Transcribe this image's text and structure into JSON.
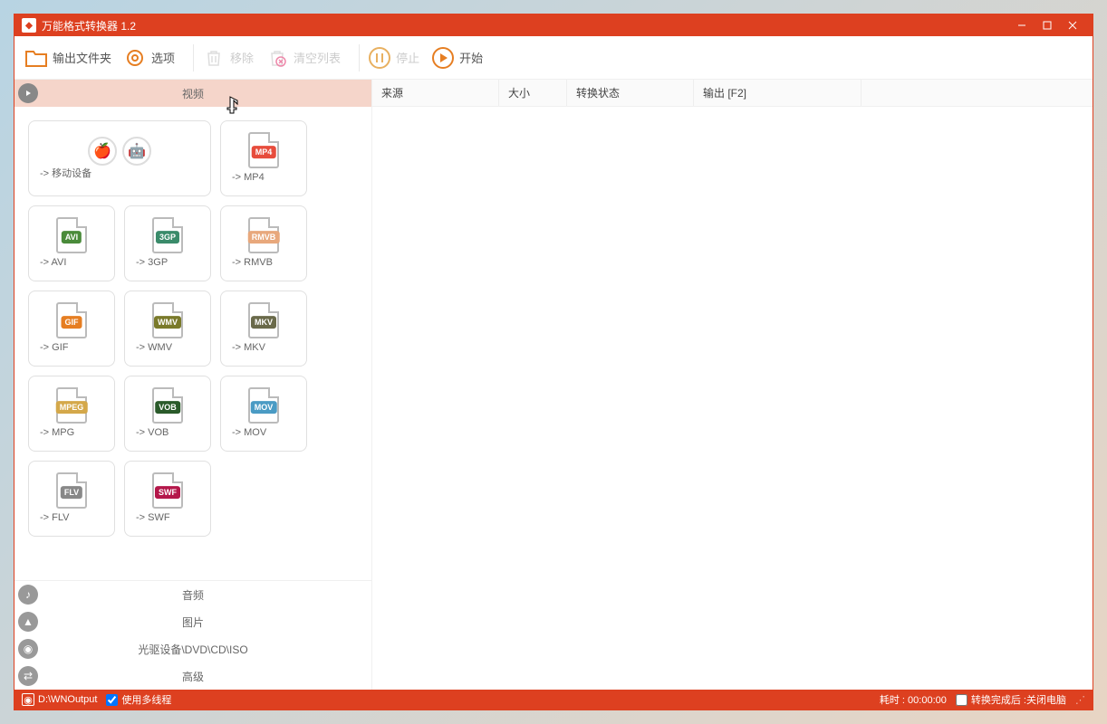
{
  "window": {
    "title": "万能格式转换器 1.2"
  },
  "toolbar": {
    "output_folder": "输出文件夹",
    "options": "选项",
    "remove": "移除",
    "clear_list": "清空列表",
    "stop": "停止",
    "start": "开始"
  },
  "categories": {
    "video": "视频",
    "audio": "音频",
    "image": "图片",
    "disc": "光驱设备\\DVD\\CD\\ISO",
    "advanced": "高级"
  },
  "formats": {
    "mobile": {
      "label": "-> 移动设备"
    },
    "mp4": {
      "badge": "MP4",
      "label": "-> MP4",
      "color": "#e74c3c"
    },
    "avi": {
      "badge": "AVI",
      "label": "-> AVI",
      "color": "#4a8b3a"
    },
    "3gp": {
      "badge": "3GP",
      "label": "-> 3GP",
      "color": "#3a8b6a"
    },
    "rmvb": {
      "badge": "RMVB",
      "label": "-> RMVB",
      "color": "#e8a87c"
    },
    "gif": {
      "badge": "GIF",
      "label": "-> GIF",
      "color": "#e67e22"
    },
    "wmv": {
      "badge": "WMV",
      "label": "-> WMV",
      "color": "#7a7a2a"
    },
    "mkv": {
      "badge": "MKV",
      "label": "-> MKV",
      "color": "#6a6a4a"
    },
    "mpeg": {
      "badge": "MPEG",
      "label": "-> MPG",
      "color": "#d4a84a"
    },
    "vob": {
      "badge": "VOB",
      "label": "-> VOB",
      "color": "#2a5a2a"
    },
    "mov": {
      "badge": "MOV",
      "label": "-> MOV",
      "color": "#4a9bc4"
    },
    "flv": {
      "badge": "FLV",
      "label": "-> FLV",
      "color": "#888"
    },
    "swf": {
      "badge": "SWF",
      "label": "-> SWF",
      "color": "#b4174a"
    }
  },
  "columns": {
    "source": "来源",
    "size": "大小",
    "status": "转换状态",
    "output": "输出 [F2]"
  },
  "statusbar": {
    "output_path": "D:\\WNOutput",
    "multithread": "使用多线程",
    "elapsed_label": "耗时 :",
    "elapsed_value": "00:00:00",
    "after_label": "转换完成后 :",
    "after_value": "关闭电脑"
  }
}
